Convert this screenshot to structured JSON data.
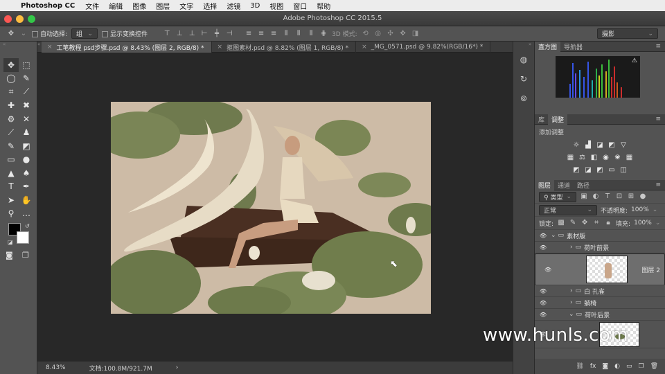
{
  "menubar": {
    "app": "Photoshop CC",
    "items": [
      "文件",
      "编辑",
      "图像",
      "图层",
      "文字",
      "选择",
      "滤镜",
      "3D",
      "视图",
      "窗口",
      "帮助"
    ]
  },
  "window": {
    "title": "Adobe Photoshop CC 2015.5"
  },
  "options": {
    "auto_select_label": "自动选择:",
    "auto_select_value": "组",
    "show_transform_label": "显示变换控件",
    "mode_3d_label": "3D 模式:",
    "workspace_value": "摄影"
  },
  "tabs": [
    {
      "label": "工笔教程 psd步骤.psd @ 8.43% (图层 2, RGB/8) *"
    },
    {
      "label": "抠图素材.psd @ 8.82% (图层 1, RGB/8) *"
    },
    {
      "label": "_MG_0571.psd @ 9.82%(RGB/16*) *"
    }
  ],
  "status": {
    "zoom": "8.43%",
    "doc": "文档:100.8M/921.7M",
    "arrow": "›"
  },
  "panels": {
    "histogram_tabs": [
      "直方图",
      "导航器"
    ],
    "adjust_tabs": [
      "库",
      "调整"
    ],
    "adjust_title": "添加调整",
    "layer_tabs": [
      "图层",
      "通道",
      "路径"
    ],
    "filter_kind": "类型",
    "blend_mode": "正常",
    "opacity_label": "不透明度:",
    "opacity_value": "100%",
    "lock_label": "锁定:",
    "fill_label": "填充:",
    "fill_value": "100%"
  },
  "layers": [
    {
      "name": "素材版",
      "type": "group-open",
      "indent": 0
    },
    {
      "name": "荷叶前景",
      "type": "group-closed",
      "indent": 1
    },
    {
      "name": "图层 2",
      "type": "layer-selected",
      "indent": 1
    },
    {
      "name": "白 孔雀",
      "type": "group-closed",
      "indent": 1
    },
    {
      "name": "躺椅",
      "type": "group-closed",
      "indent": 1
    },
    {
      "name": "荷叶后景",
      "type": "group-open",
      "indent": 1
    }
  ],
  "watermark": "www.hunls.com",
  "colors": {
    "close": "#fc5753",
    "minimize": "#fdbc40",
    "zoom": "#33c748",
    "canvas_bg": "#cdbba6"
  }
}
